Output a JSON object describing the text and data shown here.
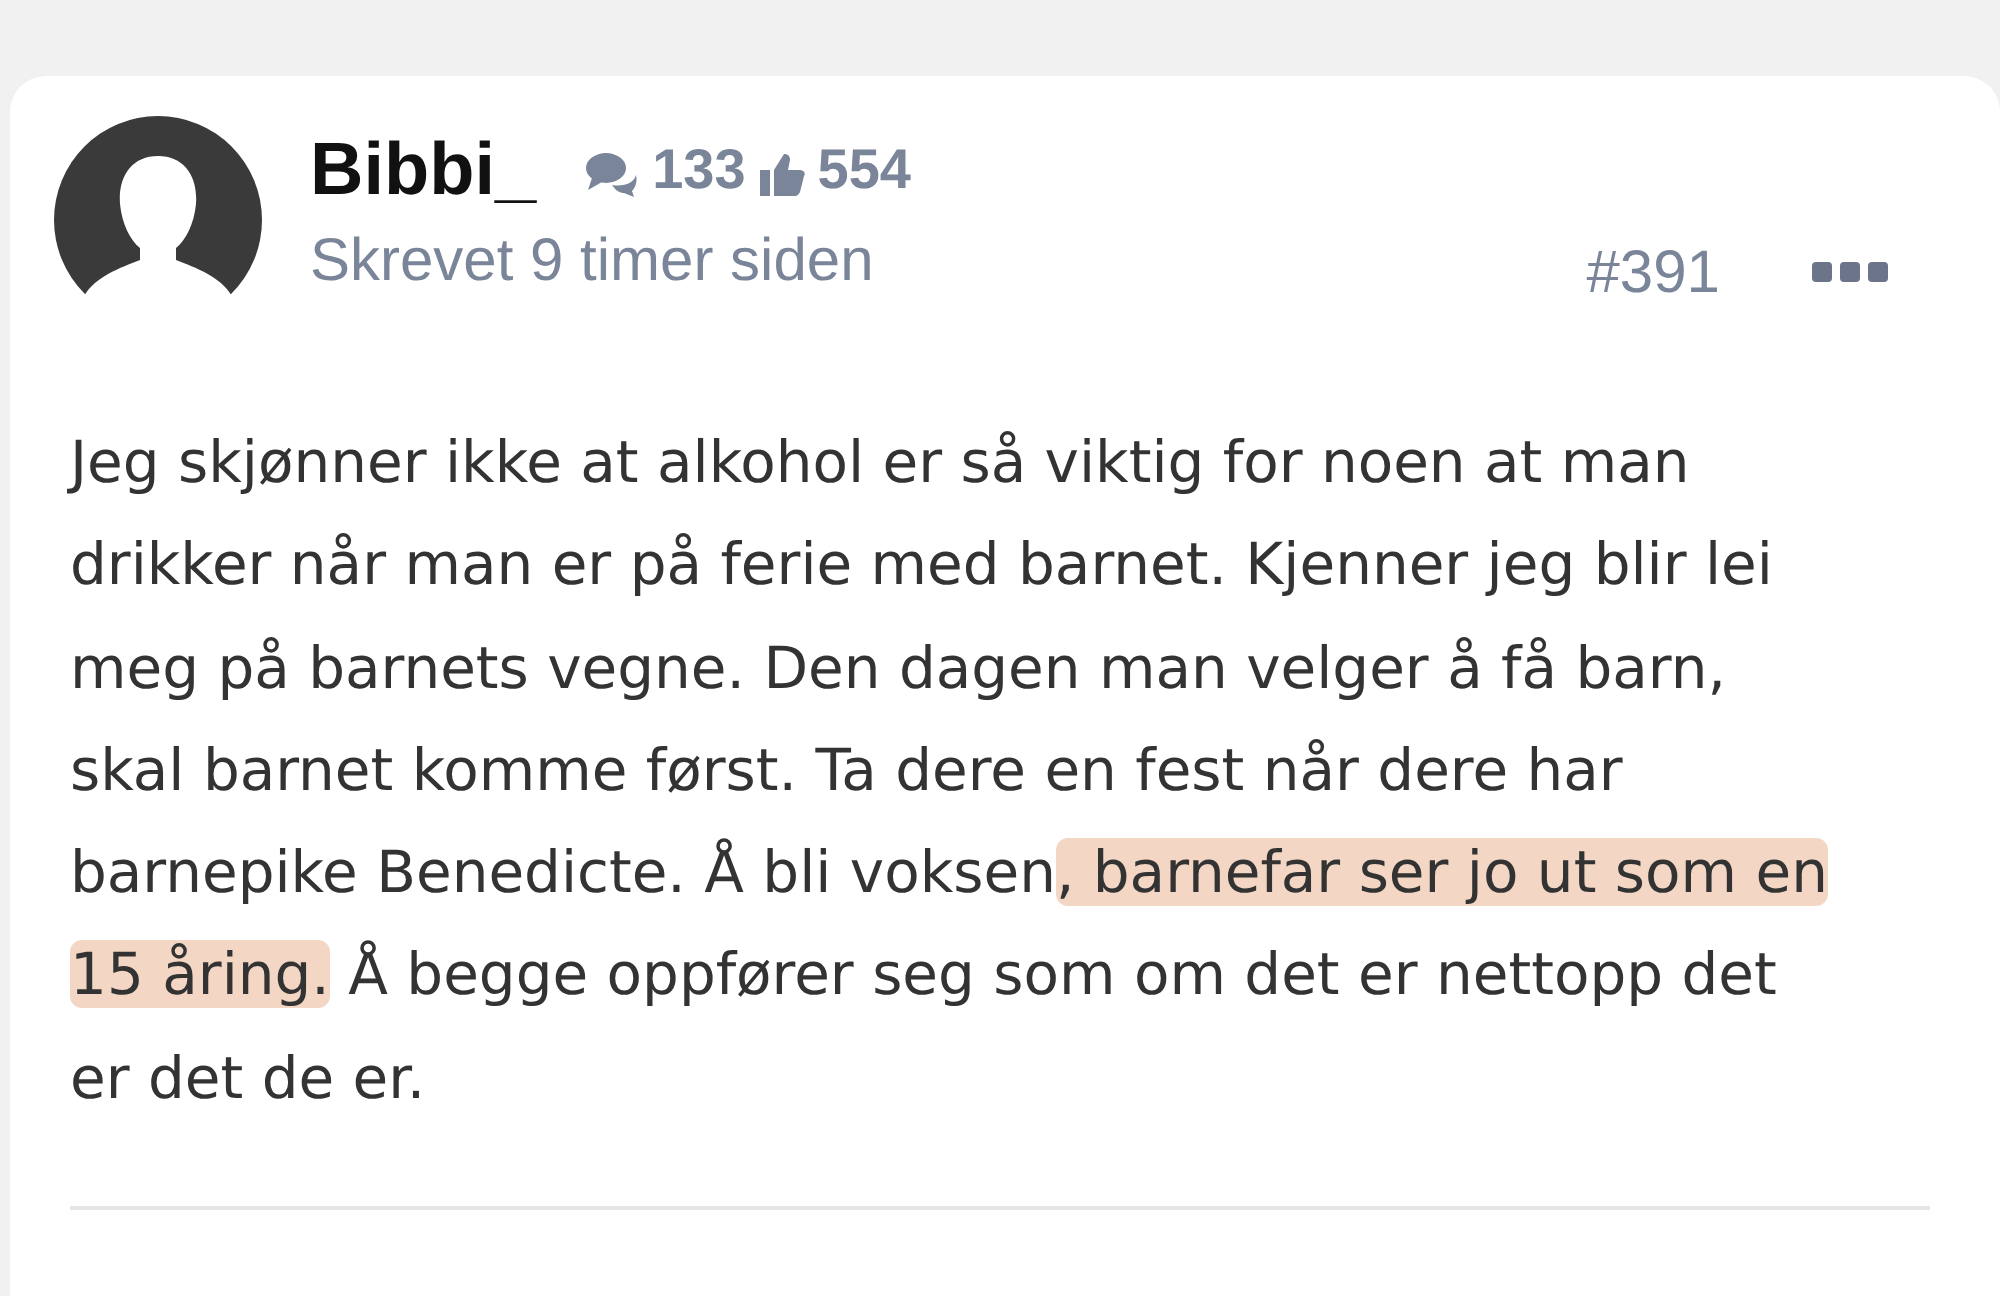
{
  "post": {
    "author": "Bibbi_",
    "comment_count": "133",
    "like_count": "554",
    "posted": "Skrevet 9 timer siden",
    "number": "#391",
    "body_lines": [
      [
        {
          "text": "Jeg skjønner ikke at alkohol er så viktig for noen at man",
          "highlighted": false
        }
      ],
      [
        {
          "text": "drikker når man er på ferie med barnet. Kjenner jeg blir lei",
          "highlighted": false
        }
      ],
      [
        {
          "text": "meg på barnets vegne. Den dagen man velger å få barn,",
          "highlighted": false
        }
      ],
      [
        {
          "text": "skal barnet komme først. Ta dere en fest når dere har",
          "highlighted": false
        }
      ],
      [
        {
          "text": "barnepike Benedicte. Å bli voksen",
          "highlighted": false
        },
        {
          "text": ", barnefar ser jo ut som en",
          "highlighted": true
        }
      ],
      [
        {
          "text": "15 åring.",
          "highlighted": true
        },
        {
          "text": " Å begge oppfører seg som om det er nettopp det",
          "highlighted": false
        }
      ],
      [
        {
          "text": "er det de er.",
          "highlighted": false
        }
      ]
    ]
  }
}
